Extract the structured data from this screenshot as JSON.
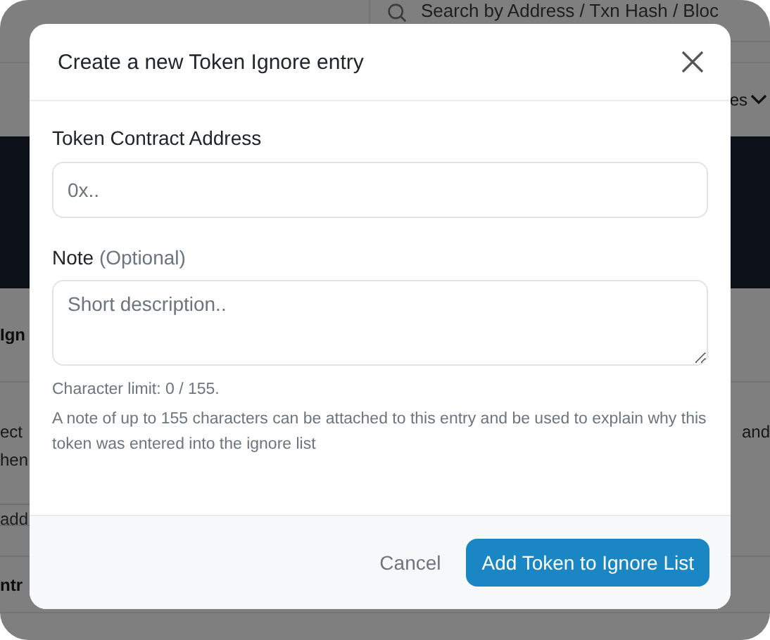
{
  "background": {
    "search": {
      "placeholder": "Search by Address / Txn Hash / Bloc"
    },
    "nav_fragment": "es",
    "heading_fragment": "Ign",
    "text_lines": [
      {
        "left": "ect",
        "right": "and"
      },
      {
        "left": "hen"
      }
    ],
    "input_fragment": "add",
    "table_fragment": "ntr"
  },
  "dialog": {
    "title": "Create a new Token Ignore entry",
    "address": {
      "label": "Token Contract Address",
      "placeholder": "0x.."
    },
    "note": {
      "label": "Note",
      "hint": "(Optional)",
      "placeholder": "Short description.."
    },
    "char_limit": "Character limit: 0 / 155.",
    "help": "A note of up to 155 characters can be attached to this entry and be used to explain why this token was entered into the ignore list",
    "buttons": {
      "cancel": "Cancel",
      "submit": "Add Token to Ignore List"
    }
  }
}
